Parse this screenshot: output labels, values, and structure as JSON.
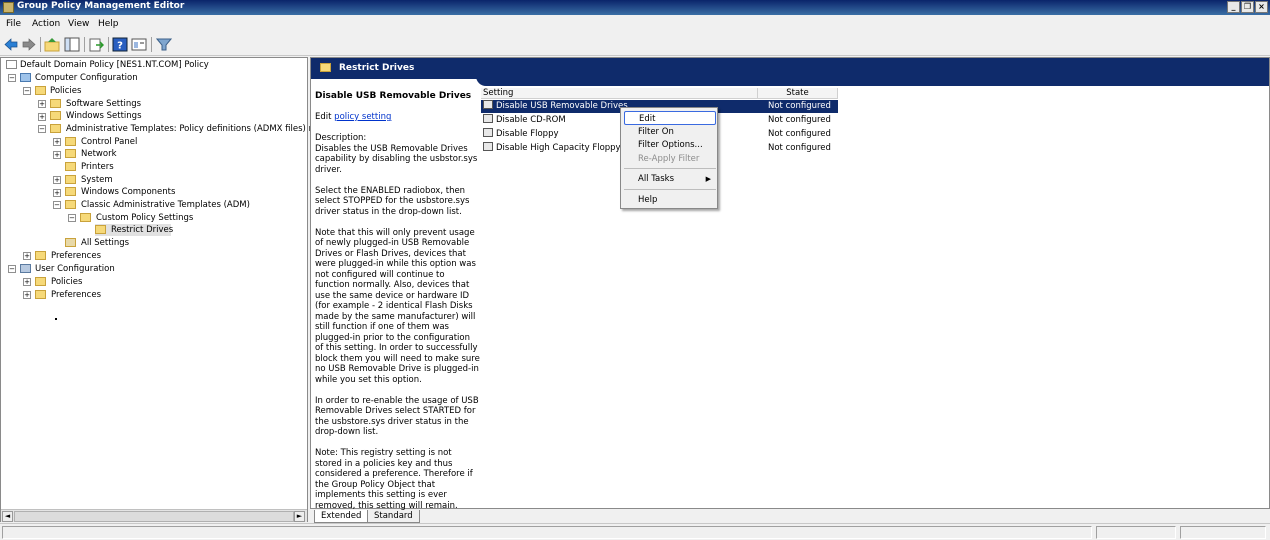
{
  "window": {
    "title": "Group Policy Management Editor"
  },
  "menu": {
    "items": [
      "File",
      "Action",
      "View",
      "Help"
    ]
  },
  "toolbar": {
    "icons": [
      "back-arrow-icon",
      "forward-arrow-icon",
      "up-folder-icon",
      "show-hide-tree-icon",
      "export-list-icon",
      "help-icon",
      "properties-icon",
      "filter-icon"
    ]
  },
  "tree": {
    "root": "Default Domain Policy [NES1.NT.COM] Policy",
    "computer_config": "Computer Configuration",
    "policies": "Policies",
    "software_settings": "Software Settings",
    "windows_settings": "Windows Settings",
    "admin_templates": "Administrative Templates: Policy definitions (ADMX files) retriev",
    "control_panel": "Control Panel",
    "network": "Network",
    "printers": "Printers",
    "system": "System",
    "windows_components": "Windows Components",
    "classic_admin": "Classic Administrative Templates (ADM)",
    "custom_policy": "Custom Policy Settings",
    "restrict_drives": "Restrict Drives",
    "all_settings": "All Settings",
    "preferences": "Preferences",
    "user_config": "User Configuration",
    "user_policies": "Policies",
    "user_preferences": "Preferences"
  },
  "right_pane": {
    "header": "Restrict Drives",
    "desc_title": "Disable USB Removable Drives",
    "edit_prefix": "Edit ",
    "edit_link": "policy setting",
    "desc_label": "Description:",
    "desc_p1": "Disables the USB Removable Drives capability by disabling the usbstor.sys driver.",
    "desc_p2": "Select the ENABLED radiobox, then select STOPPED for the usbstore.sys driver status in the drop-down list.",
    "desc_p3": "Note that this will only prevent usage of newly plugged-in USB Removable Drives or Flash Drives, devices that were plugged-in while this option was not configured will continue to function normally. Also, devices that use the same device or hardware ID (for example - 2 identical Flash Disks made by the same manufacturer) will still function if one of them was plugged-in prior to the configuration of this setting. In order to successfully block them you will need to make sure no USB Removable Drive is plugged-in while you set this option.",
    "desc_p4": "In order to re-enable the usage of USB Removable Drives select STARTED for the usbstore.sys driver status in the drop-down list.",
    "desc_p5": "Note:  This registry setting is not stored in a policies key and thus considered a preference.  Therefore if the Group Policy Object that implements this setting is ever removed, this setting will remain.",
    "columns": {
      "setting": "Setting",
      "state": "State"
    },
    "rows": [
      {
        "setting": "Disable USB Removable Drives",
        "state": "Not configured"
      },
      {
        "setting": "Disable CD-ROM",
        "state": "Not configured"
      },
      {
        "setting": "Disable Floppy",
        "state": "Not configured"
      },
      {
        "setting": "Disable High Capacity Floppy",
        "state": "Not configured"
      }
    ]
  },
  "context_menu": {
    "edit": "Edit",
    "filter_on": "Filter On",
    "filter_options": "Filter Options...",
    "reapply_filter": "Re-Apply Filter",
    "all_tasks": "All Tasks",
    "help": "Help"
  },
  "tabs": {
    "extended": "Extended",
    "standard": "Standard"
  },
  "scroll": {
    "left": "◄",
    "right": "►"
  }
}
